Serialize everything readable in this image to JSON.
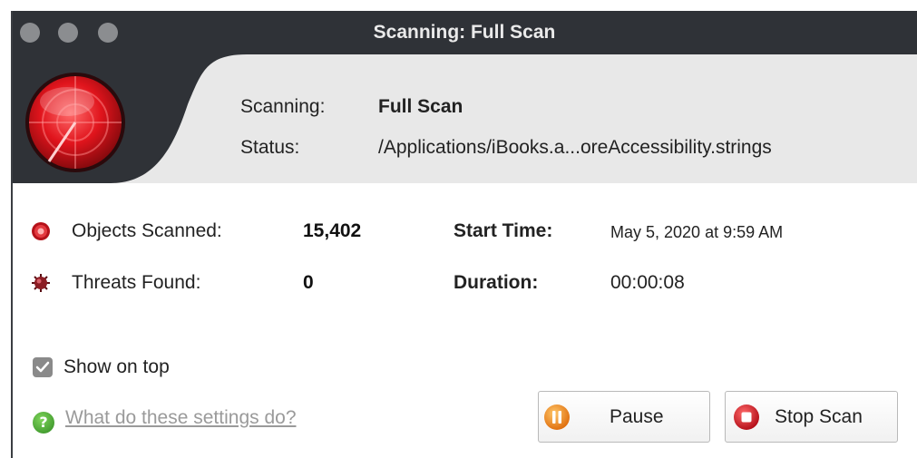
{
  "window": {
    "title": "Scanning: Full Scan"
  },
  "header": {
    "scanning_label": "Scanning:",
    "scanning_value": "Full Scan",
    "status_label": "Status:",
    "status_value": "/Applications/iBooks.a...oreAccessibility.strings"
  },
  "stats": {
    "objects_label": "Objects Scanned:",
    "objects_value": "15,402",
    "threats_label": "Threats Found:",
    "threats_value": "0",
    "start_label": "Start Time:",
    "start_value": "May 5, 2020 at 9:59 AM",
    "duration_label": "Duration:",
    "duration_value": "00:00:08"
  },
  "options": {
    "show_on_top_label": "Show on top",
    "show_on_top_checked": true,
    "help_link": "What do these settings do?"
  },
  "buttons": {
    "pause_label": "Pause",
    "stop_label": "Stop Scan"
  },
  "icons": {
    "app": "radar-icon",
    "objects": "scan-objects-icon",
    "threats": "virus-icon",
    "help": "help-icon",
    "pause": "pause-icon",
    "stop": "stop-icon"
  },
  "colors": {
    "titlebar": "#2f3237",
    "header": "#e8e8e8",
    "accent_red": "#d21c24",
    "pause_orange": "#f08a1a",
    "help_green": "#3fa12e"
  }
}
